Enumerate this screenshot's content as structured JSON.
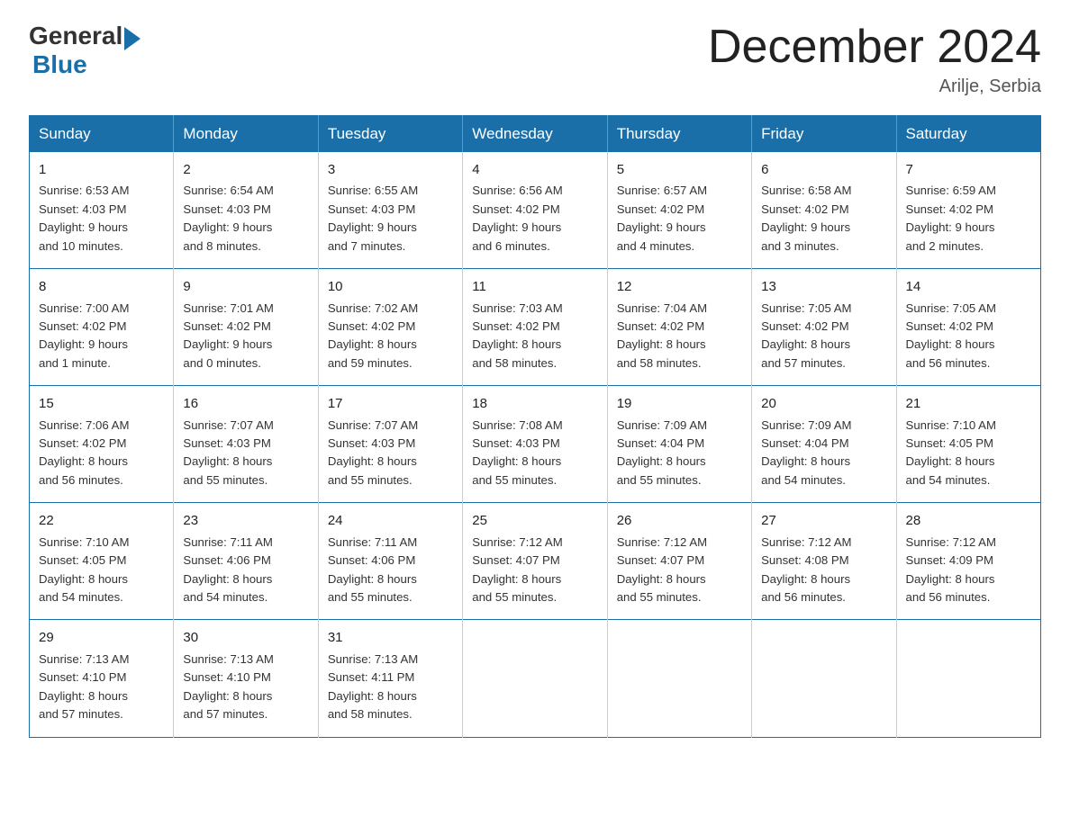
{
  "header": {
    "logo_general": "General",
    "logo_blue": "Blue",
    "month_title": "December 2024",
    "location": "Arilje, Serbia"
  },
  "weekdays": [
    "Sunday",
    "Monday",
    "Tuesday",
    "Wednesday",
    "Thursday",
    "Friday",
    "Saturday"
  ],
  "weeks": [
    [
      {
        "day": "1",
        "info": "Sunrise: 6:53 AM\nSunset: 4:03 PM\nDaylight: 9 hours\nand 10 minutes."
      },
      {
        "day": "2",
        "info": "Sunrise: 6:54 AM\nSunset: 4:03 PM\nDaylight: 9 hours\nand 8 minutes."
      },
      {
        "day": "3",
        "info": "Sunrise: 6:55 AM\nSunset: 4:03 PM\nDaylight: 9 hours\nand 7 minutes."
      },
      {
        "day": "4",
        "info": "Sunrise: 6:56 AM\nSunset: 4:02 PM\nDaylight: 9 hours\nand 6 minutes."
      },
      {
        "day": "5",
        "info": "Sunrise: 6:57 AM\nSunset: 4:02 PM\nDaylight: 9 hours\nand 4 minutes."
      },
      {
        "day": "6",
        "info": "Sunrise: 6:58 AM\nSunset: 4:02 PM\nDaylight: 9 hours\nand 3 minutes."
      },
      {
        "day": "7",
        "info": "Sunrise: 6:59 AM\nSunset: 4:02 PM\nDaylight: 9 hours\nand 2 minutes."
      }
    ],
    [
      {
        "day": "8",
        "info": "Sunrise: 7:00 AM\nSunset: 4:02 PM\nDaylight: 9 hours\nand 1 minute."
      },
      {
        "day": "9",
        "info": "Sunrise: 7:01 AM\nSunset: 4:02 PM\nDaylight: 9 hours\nand 0 minutes."
      },
      {
        "day": "10",
        "info": "Sunrise: 7:02 AM\nSunset: 4:02 PM\nDaylight: 8 hours\nand 59 minutes."
      },
      {
        "day": "11",
        "info": "Sunrise: 7:03 AM\nSunset: 4:02 PM\nDaylight: 8 hours\nand 58 minutes."
      },
      {
        "day": "12",
        "info": "Sunrise: 7:04 AM\nSunset: 4:02 PM\nDaylight: 8 hours\nand 58 minutes."
      },
      {
        "day": "13",
        "info": "Sunrise: 7:05 AM\nSunset: 4:02 PM\nDaylight: 8 hours\nand 57 minutes."
      },
      {
        "day": "14",
        "info": "Sunrise: 7:05 AM\nSunset: 4:02 PM\nDaylight: 8 hours\nand 56 minutes."
      }
    ],
    [
      {
        "day": "15",
        "info": "Sunrise: 7:06 AM\nSunset: 4:02 PM\nDaylight: 8 hours\nand 56 minutes."
      },
      {
        "day": "16",
        "info": "Sunrise: 7:07 AM\nSunset: 4:03 PM\nDaylight: 8 hours\nand 55 minutes."
      },
      {
        "day": "17",
        "info": "Sunrise: 7:07 AM\nSunset: 4:03 PM\nDaylight: 8 hours\nand 55 minutes."
      },
      {
        "day": "18",
        "info": "Sunrise: 7:08 AM\nSunset: 4:03 PM\nDaylight: 8 hours\nand 55 minutes."
      },
      {
        "day": "19",
        "info": "Sunrise: 7:09 AM\nSunset: 4:04 PM\nDaylight: 8 hours\nand 55 minutes."
      },
      {
        "day": "20",
        "info": "Sunrise: 7:09 AM\nSunset: 4:04 PM\nDaylight: 8 hours\nand 54 minutes."
      },
      {
        "day": "21",
        "info": "Sunrise: 7:10 AM\nSunset: 4:05 PM\nDaylight: 8 hours\nand 54 minutes."
      }
    ],
    [
      {
        "day": "22",
        "info": "Sunrise: 7:10 AM\nSunset: 4:05 PM\nDaylight: 8 hours\nand 54 minutes."
      },
      {
        "day": "23",
        "info": "Sunrise: 7:11 AM\nSunset: 4:06 PM\nDaylight: 8 hours\nand 54 minutes."
      },
      {
        "day": "24",
        "info": "Sunrise: 7:11 AM\nSunset: 4:06 PM\nDaylight: 8 hours\nand 55 minutes."
      },
      {
        "day": "25",
        "info": "Sunrise: 7:12 AM\nSunset: 4:07 PM\nDaylight: 8 hours\nand 55 minutes."
      },
      {
        "day": "26",
        "info": "Sunrise: 7:12 AM\nSunset: 4:07 PM\nDaylight: 8 hours\nand 55 minutes."
      },
      {
        "day": "27",
        "info": "Sunrise: 7:12 AM\nSunset: 4:08 PM\nDaylight: 8 hours\nand 56 minutes."
      },
      {
        "day": "28",
        "info": "Sunrise: 7:12 AM\nSunset: 4:09 PM\nDaylight: 8 hours\nand 56 minutes."
      }
    ],
    [
      {
        "day": "29",
        "info": "Sunrise: 7:13 AM\nSunset: 4:10 PM\nDaylight: 8 hours\nand 57 minutes."
      },
      {
        "day": "30",
        "info": "Sunrise: 7:13 AM\nSunset: 4:10 PM\nDaylight: 8 hours\nand 57 minutes."
      },
      {
        "day": "31",
        "info": "Sunrise: 7:13 AM\nSunset: 4:11 PM\nDaylight: 8 hours\nand 58 minutes."
      },
      {
        "day": "",
        "info": ""
      },
      {
        "day": "",
        "info": ""
      },
      {
        "day": "",
        "info": ""
      },
      {
        "day": "",
        "info": ""
      }
    ]
  ]
}
